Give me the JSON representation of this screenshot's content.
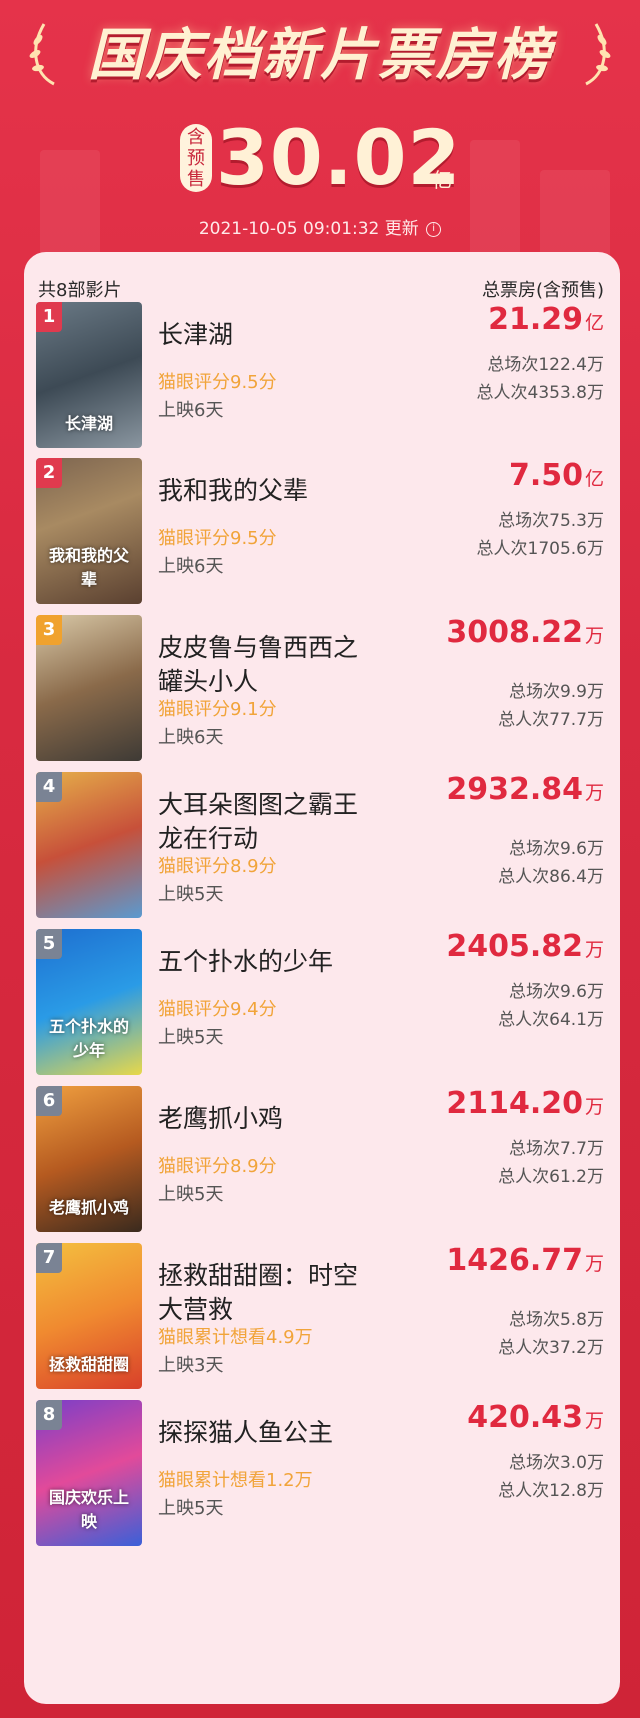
{
  "header": {
    "title": "国庆档新片票房榜",
    "presale_badge": [
      "含",
      "预",
      "售"
    ],
    "total_value": "30.02",
    "total_unit": "亿",
    "updated_time": "2021-10-05 09:01:32",
    "updated_label": "更新",
    "info_icon": "i"
  },
  "list": {
    "count_label": "共8部影片",
    "gross_label": "总票房(含预售)"
  },
  "movies": [
    {
      "rank": "1",
      "name": "长津湖",
      "score": "猫眼评分9.5分",
      "days": "上映6天",
      "gross": "21.29",
      "unit": "亿",
      "screenings": "总场次122.4万",
      "admissions": "总人次4353.8万",
      "poster_text": "长津湖"
    },
    {
      "rank": "2",
      "name": "我和我的父辈",
      "score": "猫眼评分9.5分",
      "days": "上映6天",
      "gross": "7.50",
      "unit": "亿",
      "screenings": "总场次75.3万",
      "admissions": "总人次1705.6万",
      "poster_text": "我和我的父辈"
    },
    {
      "rank": "3",
      "name": "皮皮鲁与鲁西西之罐头小人",
      "score": "猫眼评分9.1分",
      "days": "上映6天",
      "gross": "3008.22",
      "unit": "万",
      "screenings": "总场次9.9万",
      "admissions": "总人次77.7万",
      "poster_text": ""
    },
    {
      "rank": "4",
      "name": "大耳朵图图之霸王龙在行动",
      "score": "猫眼评分8.9分",
      "days": "上映5天",
      "gross": "2932.84",
      "unit": "万",
      "screenings": "总场次9.6万",
      "admissions": "总人次86.4万",
      "poster_text": ""
    },
    {
      "rank": "5",
      "name": "五个扑水的少年",
      "score": "猫眼评分9.4分",
      "days": "上映5天",
      "gross": "2405.82",
      "unit": "万",
      "screenings": "总场次9.6万",
      "admissions": "总人次64.1万",
      "poster_text": "五个扑水的少年"
    },
    {
      "rank": "6",
      "name": "老鹰抓小鸡",
      "score": "猫眼评分8.9分",
      "days": "上映5天",
      "gross": "2114.20",
      "unit": "万",
      "screenings": "总场次7.7万",
      "admissions": "总人次61.2万",
      "poster_text": "老鹰抓小鸡"
    },
    {
      "rank": "7",
      "name": "拯救甜甜圈：时空大营救",
      "score": "猫眼累计想看4.9万",
      "days": "上映3天",
      "gross": "1426.77",
      "unit": "万",
      "screenings": "总场次5.8万",
      "admissions": "总人次37.2万",
      "poster_text": "拯救甜甜圈"
    },
    {
      "rank": "8",
      "name": "探探猫人鱼公主",
      "score": "猫眼累计想看1.2万",
      "days": "上映5天",
      "gross": "420.43",
      "unit": "万",
      "screenings": "总场次3.0万",
      "admissions": "总人次12.8万",
      "poster_text": "国庆欢乐上映"
    }
  ],
  "colors": {
    "background": "#d82a40",
    "card": "#fde8ec",
    "gross": "#e0293f",
    "score": "#f1a43a",
    "rank_red": "#e03a4e",
    "rank_gold": "#f0a22e",
    "rank_gray": "#7a8394"
  }
}
